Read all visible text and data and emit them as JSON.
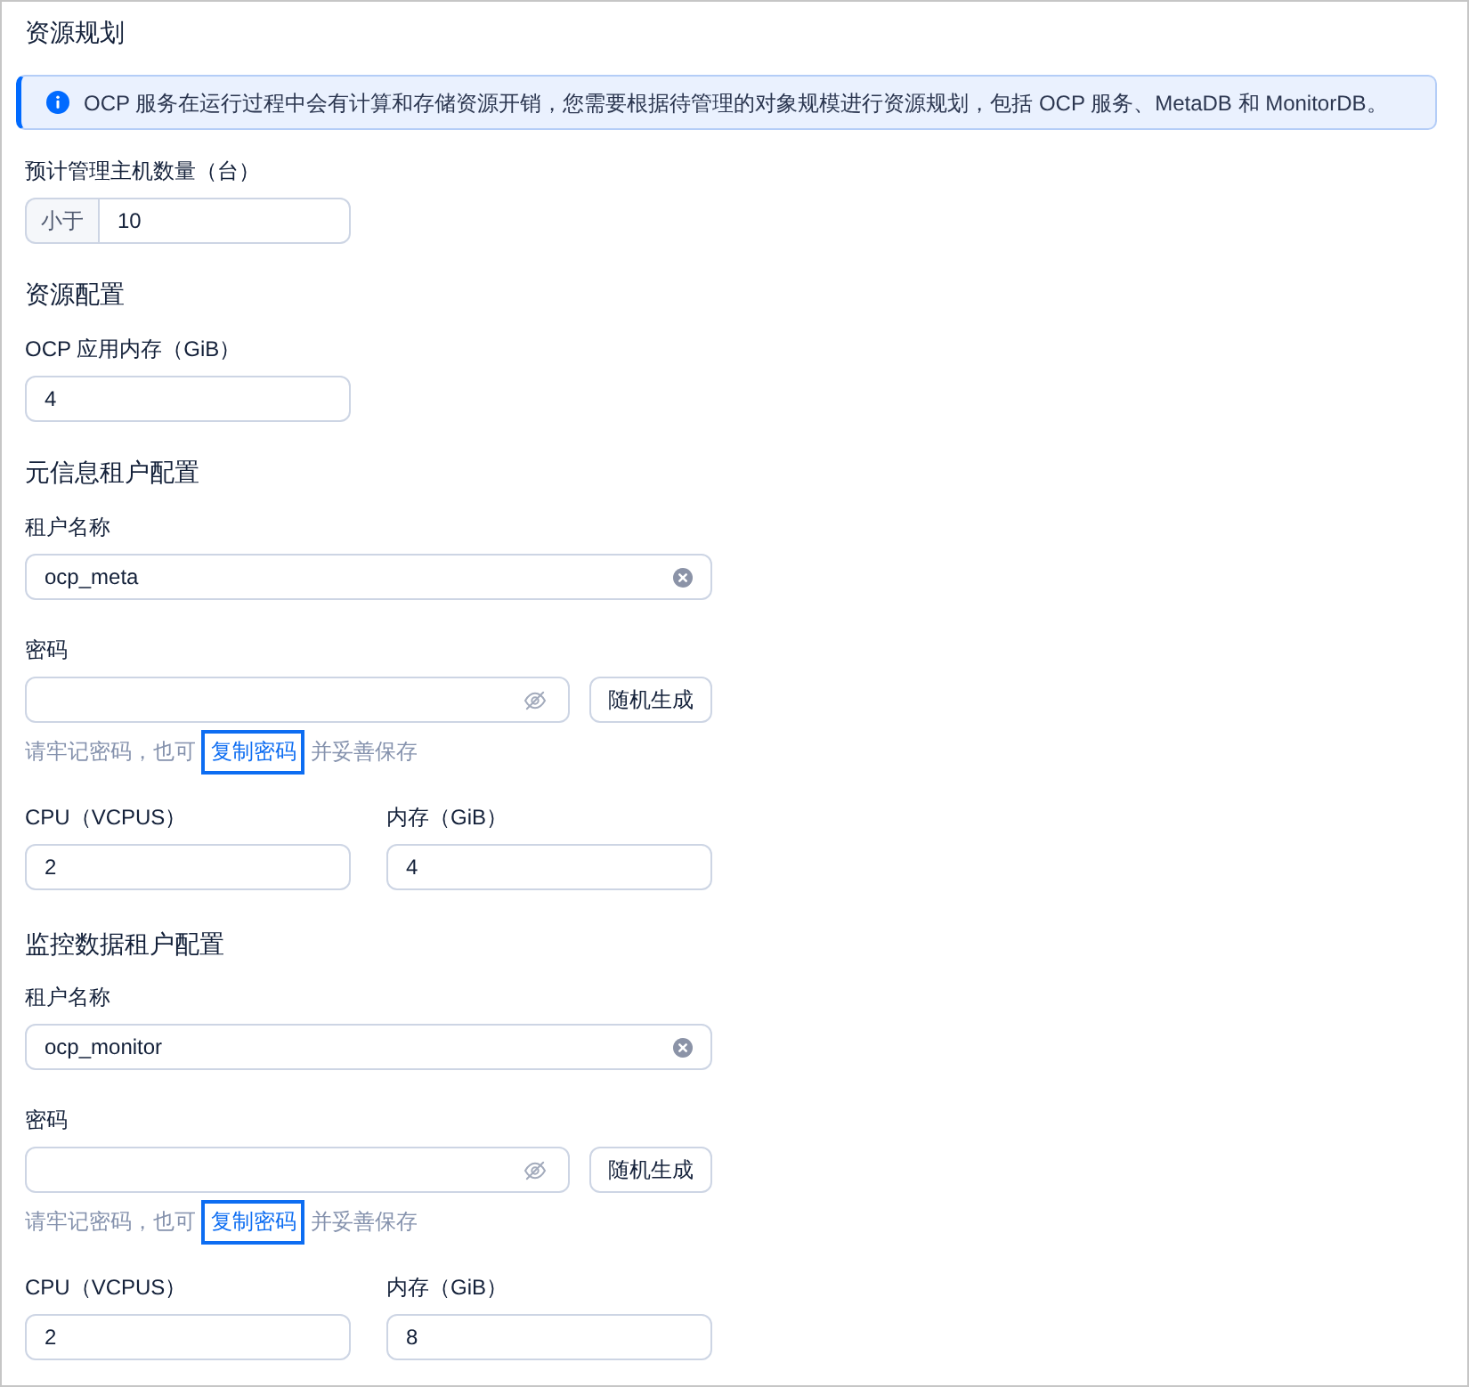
{
  "title": "资源规划",
  "alert": {
    "text": "OCP 服务在运行过程中会有计算和存储资源开销，您需要根据待管理的对象规模进行资源规划，包括 OCP 服务、MetaDB 和 MonitorDB。"
  },
  "host_count": {
    "label": "预计管理主机数量（台）",
    "addon": "小于",
    "value": "10"
  },
  "resource": {
    "title": "资源配置",
    "memory": {
      "label": "OCP 应用内存（GiB）",
      "value": "4"
    }
  },
  "tenants": [
    {
      "title": "元信息租户配置",
      "name": {
        "label": "租户名称",
        "value": "ocp_meta"
      },
      "password": {
        "label": "密码",
        "button": "随机生成",
        "hint_before": "请牢记密码，也可",
        "link": "复制密码",
        "link_focused": true,
        "hint_after": "并妥善保存"
      },
      "cpu": {
        "label": "CPU（VCPUS）",
        "value": "2"
      },
      "memory": {
        "label": "内存（GiB）",
        "value": "4"
      }
    },
    {
      "title": "监控数据租户配置",
      "name": {
        "label": "租户名称",
        "value": "ocp_monitor"
      },
      "password": {
        "label": "密码",
        "button": "随机生成",
        "hint_before": "请牢记密码，也可",
        "link": "复制密码",
        "link_focused": true,
        "hint_after": "并妥善保存"
      },
      "cpu": {
        "label": "CPU（VCPUS）",
        "value": "2"
      },
      "memory": {
        "label": "内存（GiB）",
        "value": "8"
      }
    }
  ]
}
